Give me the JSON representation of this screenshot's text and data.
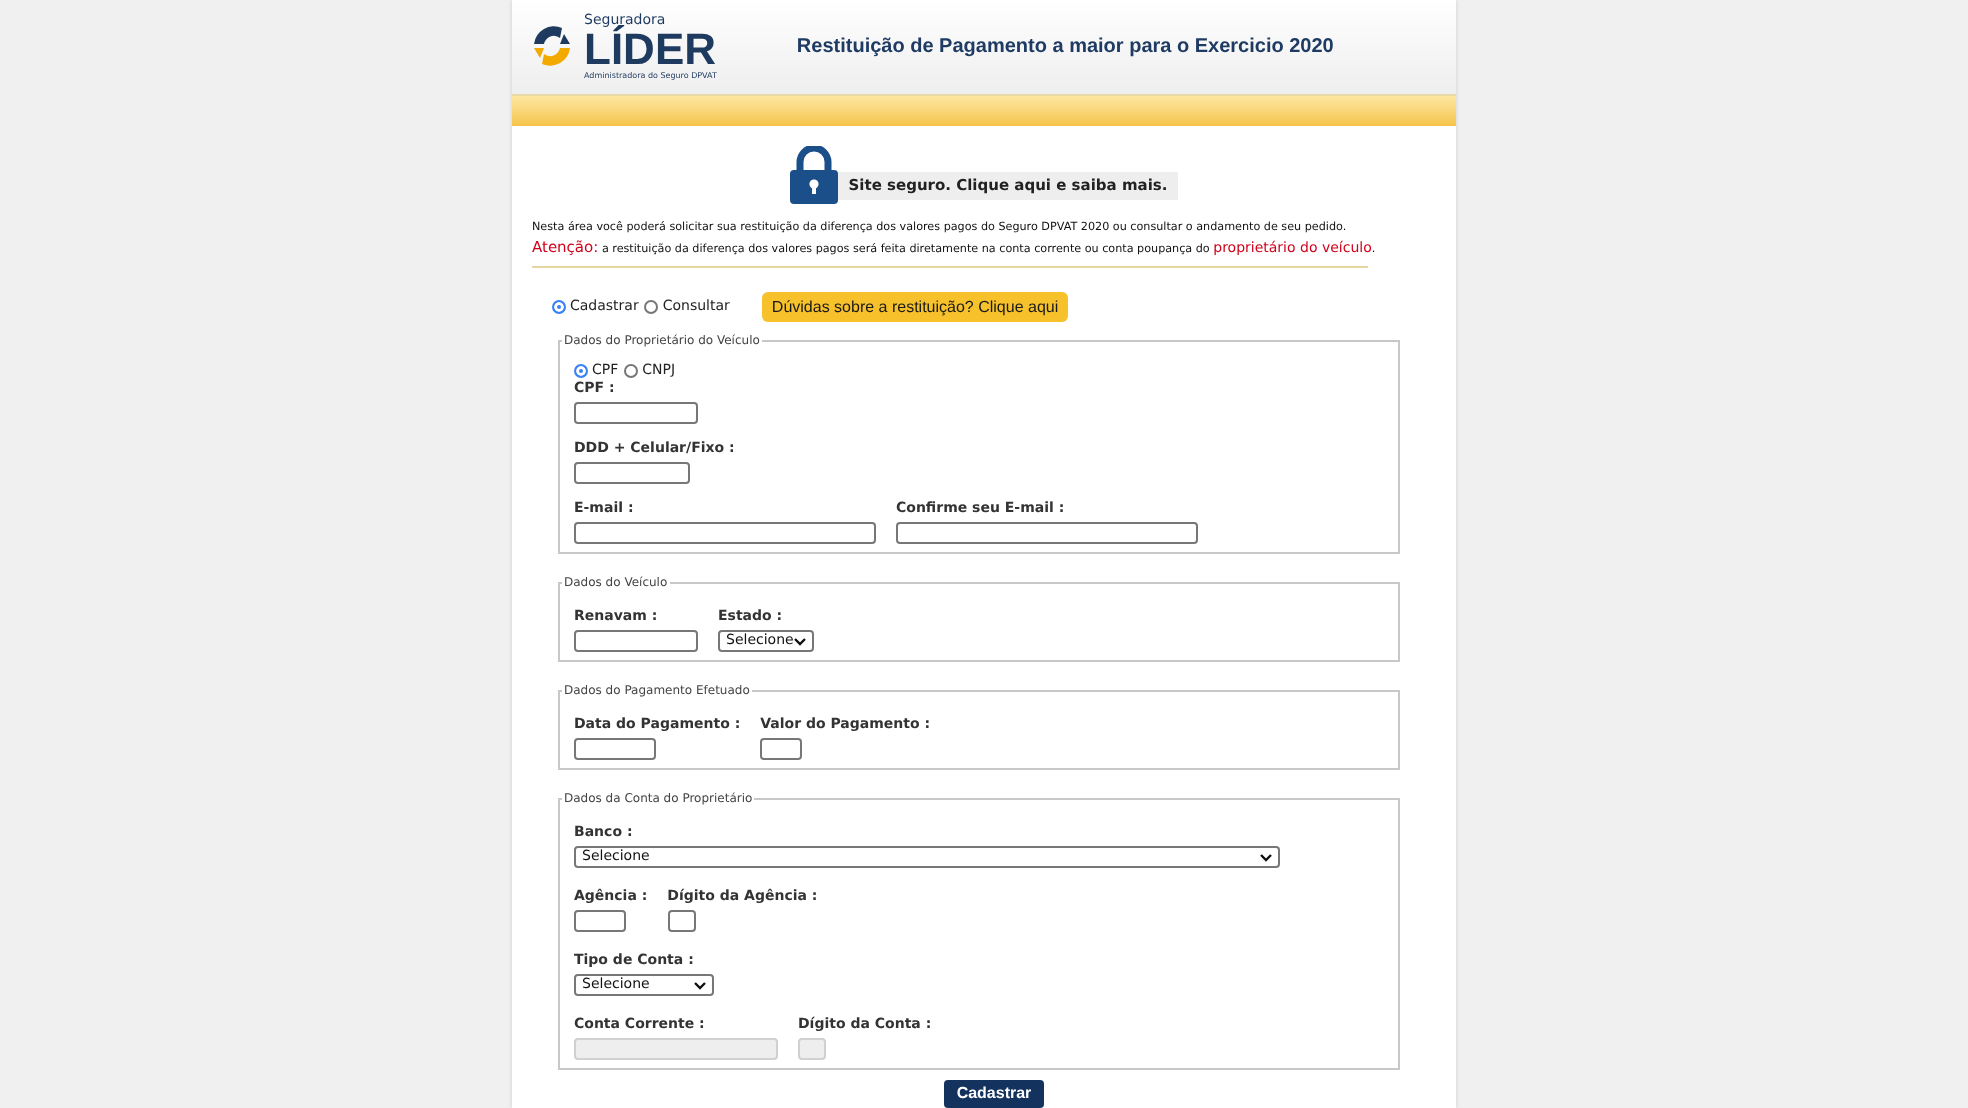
{
  "header": {
    "logo": {
      "top": "Seguradora",
      "name": "LÍDER",
      "tagline": "Administradora do Seguro DPVAT"
    },
    "title": "Restituição de Pagamento a maior para o Exercicio 2020"
  },
  "security_badge": "Site seguro. Clique aqui e saiba mais.",
  "intro": "Nesta área você poderá solicitar sua restituição da diferença dos valores pagos do Seguro DPVAT 2020 ou consultar o andamento de seu pedido.",
  "attention": {
    "label": "Atenção:",
    "text": "a restituição da diferença dos valores pagos será feita diretamente na conta corrente ou conta poupança do",
    "highlight": "proprietário do veículo",
    "end": "."
  },
  "modes": [
    {
      "label": "Cadastrar",
      "selected": true
    },
    {
      "label": "Consultar",
      "selected": false
    }
  ],
  "help_button": "Dúvidas sobre a restituição? Clique aqui",
  "sections": [
    {
      "legend": "Dados do Proprietário do Veículo",
      "doc_types": [
        {
          "label": "CPF",
          "selected": true
        },
        {
          "label": "CNPJ",
          "selected": false
        }
      ],
      "fields": [
        {
          "kind": "text",
          "label": "CPF :",
          "disabled": false
        },
        {
          "kind": "text",
          "label": "DDD + Celular/Fixo :",
          "disabled": false
        },
        {
          "kind": "text",
          "label": "E-mail :",
          "disabled": false
        },
        {
          "kind": "text",
          "label": "Confirme seu E-mail :",
          "disabled": false
        }
      ]
    },
    {
      "legend": "Dados do Veículo",
      "fields": [
        {
          "kind": "text",
          "label": "Renavam :",
          "disabled": false
        },
        {
          "kind": "select",
          "label": "Estado :",
          "value": "Selecione",
          "disabled": false
        }
      ]
    },
    {
      "legend": "Dados do Pagamento Efetuado",
      "fields": [
        {
          "kind": "text",
          "label": "Data do Pagamento :",
          "disabled": false
        },
        {
          "kind": "text",
          "label": "Valor do Pagamento :",
          "disabled": false
        }
      ]
    },
    {
      "legend": "Dados da Conta do Proprietário",
      "fields": [
        {
          "kind": "select",
          "label": "Banco :",
          "value": "Selecione",
          "disabled": false
        },
        {
          "kind": "text",
          "label": "Agência :",
          "disabled": false
        },
        {
          "kind": "text",
          "label": "Dígito da Agência :",
          "disabled": false
        },
        {
          "kind": "select",
          "label": "Tipo de Conta :",
          "value": "Selecione",
          "disabled": false
        },
        {
          "kind": "text",
          "label": "Conta Corrente :",
          "disabled": true
        },
        {
          "kind": "text",
          "label": "Dígito da Conta :",
          "disabled": true
        }
      ]
    }
  ],
  "submit_button": "Cadastrar"
}
